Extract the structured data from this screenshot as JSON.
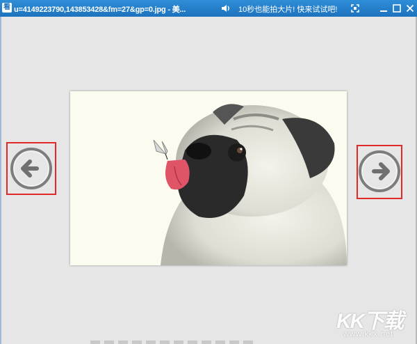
{
  "window": {
    "app_icon_glyph": "看",
    "title": "u=4149223790,143853428&fm=27&gp=0.jpg - 美...",
    "promo": "10秒也能拍大片! 快来试试吧!",
    "controls": [
      "fit-screen-icon",
      "minimize-icon",
      "maximize-icon",
      "close-icon"
    ]
  },
  "viewer": {
    "image_subject": "pug-with-butterfly-photo",
    "prev_icon": "arrow-left-icon",
    "next_icon": "arrow-right-icon",
    "highlight_color": "#e02a2a"
  },
  "watermark": {
    "logo": "KK下载",
    "url": "www.kkx.net"
  }
}
